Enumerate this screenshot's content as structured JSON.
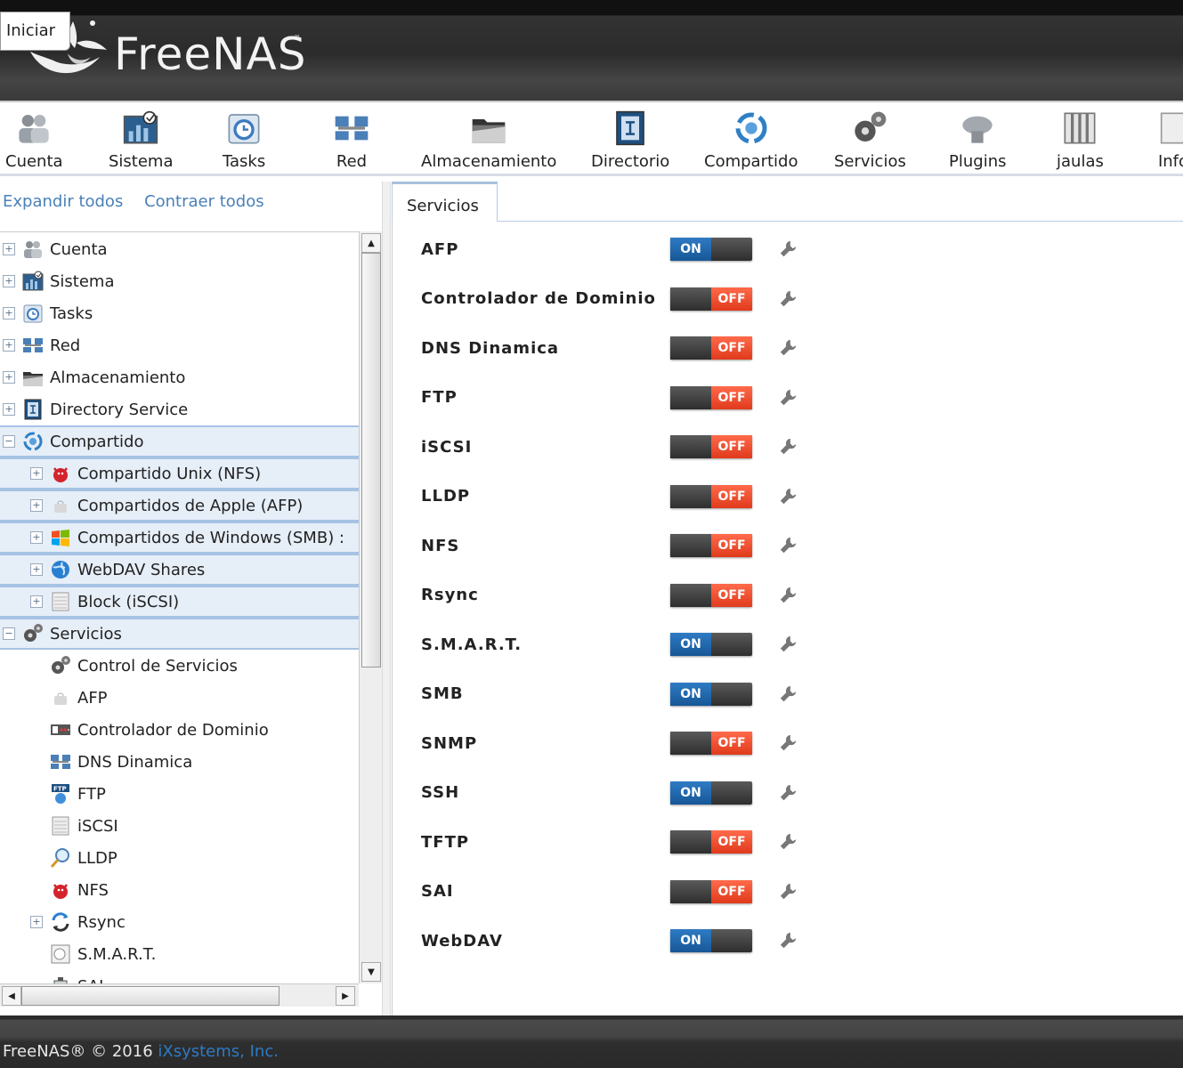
{
  "header": {
    "logo_text": "FreeNAS",
    "logo_tm": "™",
    "iniciar_label": "Iniciar"
  },
  "toolbar": {
    "items": [
      {
        "label": "Cuenta",
        "icon": "users-icon"
      },
      {
        "label": "Sistema",
        "icon": "system-chart-icon"
      },
      {
        "label": "Tasks",
        "icon": "calendar-clock-icon"
      },
      {
        "label": "Red",
        "icon": "network-icon"
      },
      {
        "label": "Almacenamiento",
        "icon": "storage-folder-icon"
      },
      {
        "label": "Directorio",
        "icon": "directory-icon"
      },
      {
        "label": "Compartido",
        "icon": "sharing-icon"
      },
      {
        "label": "Servicios",
        "icon": "gears-icon"
      },
      {
        "label": "Plugins",
        "icon": "plugins-icon"
      },
      {
        "label": "jaulas",
        "icon": "jails-icon"
      },
      {
        "label": "Info",
        "icon": "info-icon"
      }
    ]
  },
  "left": {
    "expand_all": "Expandir todos",
    "collapse_all": "Contraer todos",
    "tree": [
      {
        "label": "Cuenta",
        "level": 0,
        "expander": "+",
        "icon": "users-icon"
      },
      {
        "label": "Sistema",
        "level": 0,
        "expander": "+",
        "icon": "system-chart-icon"
      },
      {
        "label": "Tasks",
        "level": 0,
        "expander": "+",
        "icon": "calendar-clock-icon"
      },
      {
        "label": "Red",
        "level": 0,
        "expander": "+",
        "icon": "network-icon"
      },
      {
        "label": "Almacenamiento",
        "level": 0,
        "expander": "+",
        "icon": "storage-folder-icon"
      },
      {
        "label": "Directory Service",
        "level": 0,
        "expander": "+",
        "icon": "directory-icon"
      },
      {
        "label": "Compartido",
        "level": 0,
        "expander": "−",
        "icon": "sharing-icon",
        "highlight": true
      },
      {
        "label": "Compartido Unix (NFS)",
        "level": 1,
        "expander": "+",
        "icon": "bsd-daemon-icon",
        "highlight": true
      },
      {
        "label": "Compartidos de Apple (AFP)",
        "level": 1,
        "expander": "+",
        "icon": "apple-icon",
        "highlight": true
      },
      {
        "label": "Compartidos de Windows (SMB) :",
        "level": 1,
        "expander": "+",
        "icon": "windows-icon",
        "highlight": true
      },
      {
        "label": "WebDAV Shares",
        "level": 1,
        "expander": "+",
        "icon": "globe-icon",
        "highlight": true
      },
      {
        "label": "Block (iSCSI)",
        "level": 1,
        "expander": "+",
        "icon": "block-disk-icon",
        "highlight": true
      },
      {
        "label": "Servicios",
        "level": 0,
        "expander": "−",
        "icon": "gears-icon",
        "highlight": true
      },
      {
        "label": "Control de Servicios",
        "level": 1,
        "expander": "",
        "icon": "gears-icon"
      },
      {
        "label": "AFP",
        "level": 1,
        "expander": "",
        "icon": "apple-icon"
      },
      {
        "label": "Controlador de Dominio",
        "level": 1,
        "expander": "",
        "icon": "domain-controller-icon"
      },
      {
        "label": "DNS Dinamica",
        "level": 1,
        "expander": "",
        "icon": "network-icon"
      },
      {
        "label": "FTP",
        "level": 1,
        "expander": "",
        "icon": "ftp-icon"
      },
      {
        "label": "iSCSI",
        "level": 1,
        "expander": "",
        "icon": "block-disk-icon"
      },
      {
        "label": "LLDP",
        "level": 1,
        "expander": "",
        "icon": "magnifier-icon"
      },
      {
        "label": "NFS",
        "level": 1,
        "expander": "",
        "icon": "bsd-daemon-icon"
      },
      {
        "label": "Rsync",
        "level": 1,
        "expander": "+",
        "icon": "sync-arrows-icon"
      },
      {
        "label": "S.M.A.R.T.",
        "level": 1,
        "expander": "",
        "icon": "smart-disk-icon"
      },
      {
        "label": "SAI",
        "level": 1,
        "expander": "",
        "icon": "ups-icon"
      }
    ]
  },
  "content": {
    "tab_label": "Servicios",
    "on_label": "ON",
    "off_label": "OFF",
    "services": [
      {
        "name": "AFP",
        "state": "on"
      },
      {
        "name": "Controlador de Dominio",
        "state": "off"
      },
      {
        "name": "DNS Dinamica",
        "state": "off"
      },
      {
        "name": "FTP",
        "state": "off"
      },
      {
        "name": "iSCSI",
        "state": "off"
      },
      {
        "name": "LLDP",
        "state": "off"
      },
      {
        "name": "NFS",
        "state": "off"
      },
      {
        "name": "Rsync",
        "state": "off"
      },
      {
        "name": "S.M.A.R.T.",
        "state": "on"
      },
      {
        "name": "SMB",
        "state": "on"
      },
      {
        "name": "SNMP",
        "state": "off"
      },
      {
        "name": "SSH",
        "state": "on"
      },
      {
        "name": "TFTP",
        "state": "off"
      },
      {
        "name": "SAI",
        "state": "off"
      },
      {
        "name": "WebDAV",
        "state": "on"
      }
    ]
  },
  "footer": {
    "copyright": "FreeNAS® © 2016 ",
    "company": "iXsystems, Inc."
  },
  "colors": {
    "on_blue": "#1f6bb0",
    "off_red": "#f04a2a",
    "link_blue": "#4a80b8",
    "tree_highlight": "#e6eef8"
  }
}
